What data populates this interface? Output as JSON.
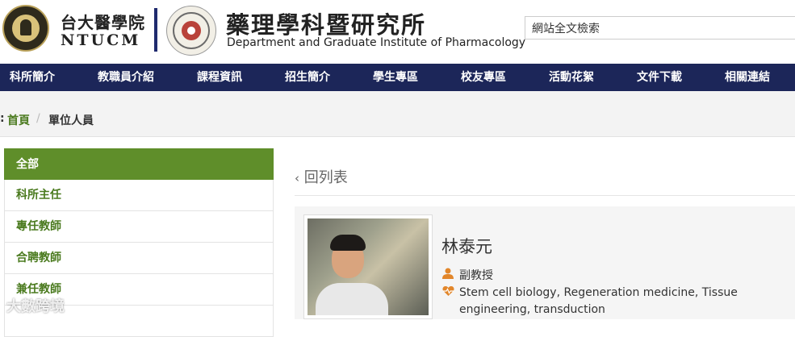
{
  "header": {
    "ntu_cn": "台大醫學院",
    "ntu_en": "NTUCM",
    "dept_cn": "藥理學科暨研究所",
    "dept_en": "Department and Graduate Institute of Pharmacology",
    "search_placeholder": "網站全文檢索"
  },
  "nav": {
    "items": [
      "科所簡介",
      "教職員介紹",
      "課程資訊",
      "招生簡介",
      "學生專區",
      "校友專區",
      "活動花絮",
      "文件下載",
      "相關連結"
    ]
  },
  "breadcrumb": {
    "colon": ":",
    "home": "首頁",
    "separator": "/",
    "current": "單位人員"
  },
  "sidebar": {
    "items": [
      "全部",
      "科所主任",
      "專任教師",
      "合聘教師",
      "兼任教師"
    ]
  },
  "main": {
    "back_label": "回列表",
    "back_icon": "chevron-left-icon",
    "person": {
      "name": "林泰元",
      "title": "副教授",
      "research": "Stem cell biology, Regeneration medicine, Tissue engineering, transduction"
    }
  },
  "colors": {
    "nav_bg": "#1c2659",
    "accent_green": "#5f8e2a",
    "link_green": "#4a7a1e",
    "icon_orange": "#e2862a"
  },
  "watermark": "大數跨境"
}
